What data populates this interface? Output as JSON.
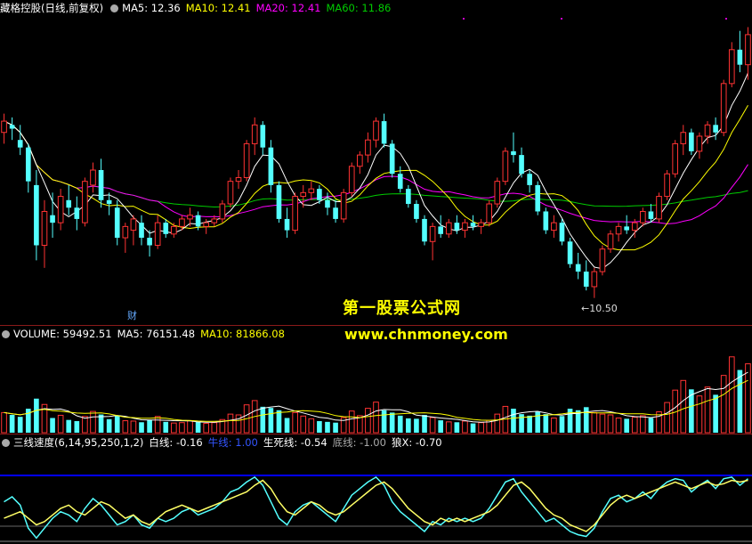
{
  "header": {
    "title": "藏格控股(日线,前复权)",
    "ma5": "MA5: 12.36",
    "ma10": "MA10: 12.41",
    "ma20": "MA20: 12.41",
    "ma60": "MA60: 11.86"
  },
  "volume_header": {
    "volume": "VOLUME: 59492.51",
    "ma5": "MA5: 76151.48",
    "ma10": "MA10: 81866.08"
  },
  "indicator_header": {
    "name": "三线速度(6,14,95,250,1,2)",
    "white": "白线: -0.16",
    "bull": "牛线: 1.00",
    "life": "生死线: -0.54",
    "bottom": "底线: -1.00",
    "wolf": "狼X: -0.70"
  },
  "annotations": {
    "watermark_cn": "第一股票公式网",
    "watermark_url": "www.chnmoney.com",
    "cai": "财",
    "min_label": "←10.50"
  },
  "colors": {
    "up": "#ff3333",
    "down": "#54ffff",
    "ma5": "#ffffff",
    "ma10": "#ffff00",
    "ma20": "#ff00ff",
    "ma60": "#00cc00",
    "bull": "#0000ff",
    "white_line": "#54ffff",
    "yellow_line": "#ffff66"
  },
  "chart_data": [
    {
      "type": "candlestick",
      "title": "藏格控股(日线,前复权)",
      "ylim": [
        10.2,
        14.2
      ],
      "ohlc": [
        [
          12.7,
          12.95,
          12.55,
          12.85
        ],
        [
          12.8,
          12.9,
          12.6,
          12.75
        ],
        [
          12.6,
          12.8,
          12.4,
          12.5
        ],
        [
          12.5,
          12.55,
          11.9,
          12.05
        ],
        [
          12.0,
          12.2,
          11.0,
          11.2
        ],
        [
          11.2,
          11.8,
          10.9,
          11.65
        ],
        [
          11.6,
          11.9,
          11.3,
          11.5
        ],
        [
          11.5,
          11.95,
          11.4,
          11.85
        ],
        [
          11.8,
          12.0,
          11.6,
          11.7
        ],
        [
          11.7,
          11.85,
          11.4,
          11.55
        ],
        [
          11.5,
          12.1,
          11.45,
          12.05
        ],
        [
          12.0,
          12.3,
          11.9,
          12.2
        ],
        [
          12.2,
          12.35,
          11.7,
          11.8
        ],
        [
          11.8,
          11.9,
          11.6,
          11.75
        ],
        [
          11.7,
          11.8,
          11.2,
          11.3
        ],
        [
          11.3,
          11.5,
          11.1,
          11.45
        ],
        [
          11.4,
          11.6,
          11.2,
          11.55
        ],
        [
          11.5,
          11.6,
          11.2,
          11.3
        ],
        [
          11.3,
          11.4,
          11.05,
          11.2
        ],
        [
          11.2,
          11.6,
          11.15,
          11.5
        ],
        [
          11.5,
          11.55,
          11.3,
          11.35
        ],
        [
          11.35,
          11.5,
          11.3,
          11.45
        ],
        [
          11.45,
          11.6,
          11.4,
          11.55
        ],
        [
          11.55,
          11.7,
          11.45,
          11.6
        ],
        [
          11.6,
          11.65,
          11.4,
          11.45
        ],
        [
          11.45,
          11.55,
          11.35,
          11.5
        ],
        [
          11.5,
          11.6,
          11.45,
          11.55
        ],
        [
          11.55,
          11.8,
          11.5,
          11.75
        ],
        [
          11.75,
          12.1,
          11.7,
          12.05
        ],
        [
          12.05,
          12.2,
          11.95,
          12.1
        ],
        [
          12.1,
          12.6,
          12.05,
          12.55
        ],
        [
          12.55,
          12.9,
          12.4,
          12.8
        ],
        [
          12.8,
          12.85,
          12.4,
          12.5
        ],
        [
          12.5,
          12.6,
          11.9,
          12.0
        ],
        [
          12.0,
          12.05,
          11.5,
          11.55
        ],
        [
          11.55,
          11.7,
          11.3,
          11.4
        ],
        [
          11.4,
          11.9,
          11.35,
          11.85
        ],
        [
          11.85,
          12.0,
          11.7,
          11.9
        ],
        [
          11.9,
          12.05,
          11.8,
          11.95
        ],
        [
          11.95,
          12.0,
          11.75,
          11.8
        ],
        [
          11.8,
          11.9,
          11.6,
          11.7
        ],
        [
          11.7,
          11.8,
          11.5,
          11.55
        ],
        [
          11.55,
          11.95,
          11.5,
          11.9
        ],
        [
          11.9,
          12.3,
          11.85,
          12.25
        ],
        [
          12.25,
          12.45,
          12.15,
          12.4
        ],
        [
          12.4,
          12.7,
          12.3,
          12.6
        ],
        [
          12.6,
          12.9,
          12.5,
          12.85
        ],
        [
          12.85,
          12.95,
          12.5,
          12.55
        ],
        [
          12.55,
          12.6,
          12.1,
          12.15
        ],
        [
          12.15,
          12.25,
          11.9,
          11.95
        ],
        [
          11.95,
          12.0,
          11.7,
          11.75
        ],
        [
          11.75,
          11.8,
          11.5,
          11.55
        ],
        [
          11.55,
          11.6,
          11.2,
          11.25
        ],
        [
          11.25,
          11.5,
          11.0,
          11.45
        ],
        [
          11.45,
          11.6,
          11.3,
          11.35
        ],
        [
          11.35,
          11.55,
          11.3,
          11.5
        ],
        [
          11.5,
          11.6,
          11.35,
          11.4
        ],
        [
          11.4,
          11.55,
          11.3,
          11.5
        ],
        [
          11.5,
          11.6,
          11.4,
          11.45
        ],
        [
          11.45,
          11.55,
          11.35,
          11.5
        ],
        [
          11.5,
          11.8,
          11.45,
          11.75
        ],
        [
          11.75,
          12.1,
          11.7,
          12.05
        ],
        [
          12.05,
          12.5,
          12.0,
          12.45
        ],
        [
          12.45,
          12.7,
          12.3,
          12.4
        ],
        [
          12.4,
          12.5,
          12.1,
          12.15
        ],
        [
          12.15,
          12.2,
          11.9,
          12.0
        ],
        [
          12.0,
          12.05,
          11.6,
          11.65
        ],
        [
          11.65,
          11.7,
          11.35,
          11.4
        ],
        [
          11.4,
          11.6,
          11.3,
          11.5
        ],
        [
          11.5,
          11.55,
          11.2,
          11.25
        ],
        [
          11.25,
          11.3,
          10.9,
          10.95
        ],
        [
          10.95,
          11.1,
          10.75,
          10.85
        ],
        [
          10.85,
          11.0,
          10.6,
          10.65
        ],
        [
          10.65,
          10.9,
          10.5,
          10.85
        ],
        [
          10.85,
          11.2,
          10.8,
          11.15
        ],
        [
          11.15,
          11.4,
          11.1,
          11.35
        ],
        [
          11.35,
          11.5,
          11.25,
          11.45
        ],
        [
          11.45,
          11.6,
          11.35,
          11.4
        ],
        [
          11.4,
          11.55,
          11.3,
          11.5
        ],
        [
          11.5,
          11.7,
          11.45,
          11.65
        ],
        [
          11.65,
          11.75,
          11.5,
          11.55
        ],
        [
          11.55,
          11.9,
          11.5,
          11.85
        ],
        [
          11.85,
          12.2,
          11.8,
          12.15
        ],
        [
          12.15,
          12.6,
          12.1,
          12.55
        ],
        [
          12.55,
          12.8,
          12.4,
          12.7
        ],
        [
          12.7,
          12.75,
          12.4,
          12.45
        ],
        [
          12.45,
          12.7,
          12.35,
          12.65
        ],
        [
          12.65,
          12.85,
          12.55,
          12.8
        ],
        [
          12.8,
          12.9,
          12.6,
          12.7
        ],
        [
          12.7,
          13.4,
          12.65,
          13.35
        ],
        [
          13.35,
          13.9,
          13.3,
          13.8
        ],
        [
          13.8,
          14.05,
          13.5,
          13.6
        ],
        [
          13.6,
          14.1,
          13.4,
          14.0
        ]
      ],
      "min_price": 10.5
    },
    {
      "type": "bar",
      "title": "VOLUME",
      "ylim": [
        0,
        230000
      ],
      "values": [
        52000,
        46000,
        41000,
        62000,
        88000,
        73000,
        38000,
        45000,
        33000,
        30000,
        42000,
        55000,
        47000,
        35000,
        44000,
        31000,
        30000,
        27000,
        33000,
        42000,
        28000,
        25000,
        26000,
        31000,
        29000,
        24000,
        26000,
        34000,
        48000,
        46000,
        72000,
        83000,
        67000,
        64000,
        58000,
        38000,
        52000,
        43000,
        36000,
        30000,
        28000,
        26000,
        39000,
        56000,
        44000,
        63000,
        79000,
        58000,
        52000,
        44000,
        37000,
        36000,
        46000,
        39000,
        32000,
        28000,
        27000,
        30000,
        24000,
        26000,
        32000,
        48000,
        68000,
        62000,
        48000,
        44000,
        54000,
        48000,
        38000,
        43000,
        62000,
        58000,
        66000,
        52000,
        48000,
        46000,
        38000,
        36000,
        40000,
        44000,
        38000,
        54000,
        78000,
        110000,
        135000,
        112000,
        95000,
        118000,
        98000,
        148000,
        196000,
        162000,
        178000
      ]
    },
    {
      "type": "line",
      "title": "三线速度(6,14,95,250,1,2)",
      "ylim": [
        -1.0,
        1.0
      ],
      "series": [
        {
          "name": "白线",
          "values": [
            0.2,
            0.35,
            0.1,
            -0.6,
            -0.9,
            -0.6,
            -0.3,
            -0.1,
            -0.2,
            -0.4,
            0.0,
            0.3,
            0.1,
            -0.2,
            -0.5,
            -0.4,
            -0.2,
            -0.5,
            -0.6,
            -0.3,
            -0.4,
            -0.3,
            -0.1,
            0.0,
            -0.2,
            -0.1,
            0.0,
            0.2,
            0.5,
            0.6,
            0.8,
            0.95,
            0.7,
            0.2,
            -0.3,
            -0.5,
            -0.1,
            0.1,
            0.2,
            0.0,
            -0.2,
            -0.4,
            0.0,
            0.4,
            0.6,
            0.8,
            0.95,
            0.7,
            0.2,
            -0.1,
            -0.3,
            -0.5,
            -0.7,
            -0.4,
            -0.5,
            -0.3,
            -0.4,
            -0.3,
            -0.4,
            -0.3,
            0.0,
            0.4,
            0.8,
            0.9,
            0.5,
            0.2,
            -0.1,
            -0.4,
            -0.3,
            -0.5,
            -0.7,
            -0.8,
            -0.85,
            -0.6,
            -0.1,
            0.3,
            0.4,
            0.2,
            0.3,
            0.5,
            0.3,
            0.6,
            0.8,
            0.9,
            0.85,
            0.5,
            0.7,
            0.85,
            0.6,
            0.9,
            0.95,
            0.7,
            0.9
          ]
        },
        {
          "name": "狼X",
          "values": [
            -0.3,
            -0.2,
            -0.1,
            -0.3,
            -0.5,
            -0.4,
            -0.2,
            0.0,
            0.1,
            -0.1,
            -0.2,
            0.0,
            0.2,
            0.1,
            -0.1,
            -0.3,
            -0.2,
            -0.4,
            -0.5,
            -0.3,
            -0.1,
            0.0,
            0.1,
            0.0,
            -0.1,
            0.0,
            0.1,
            0.2,
            0.3,
            0.4,
            0.5,
            0.7,
            0.85,
            0.6,
            0.2,
            -0.1,
            -0.2,
            0.0,
            0.2,
            0.1,
            -0.1,
            -0.2,
            -0.1,
            0.1,
            0.3,
            0.5,
            0.7,
            0.8,
            0.6,
            0.3,
            0.0,
            -0.2,
            -0.4,
            -0.5,
            -0.3,
            -0.4,
            -0.3,
            -0.4,
            -0.3,
            -0.2,
            -0.1,
            0.1,
            0.4,
            0.7,
            0.8,
            0.6,
            0.3,
            0.0,
            -0.2,
            -0.3,
            -0.5,
            -0.6,
            -0.7,
            -0.5,
            -0.2,
            0.1,
            0.3,
            0.4,
            0.3,
            0.4,
            0.5,
            0.6,
            0.7,
            0.8,
            0.7,
            0.6,
            0.7,
            0.8,
            0.7,
            0.75,
            0.85,
            0.8,
            0.85
          ]
        }
      ],
      "levels": {
        "牛线": 1.0,
        "底线": -1.0,
        "生死线": -0.54
      }
    }
  ]
}
